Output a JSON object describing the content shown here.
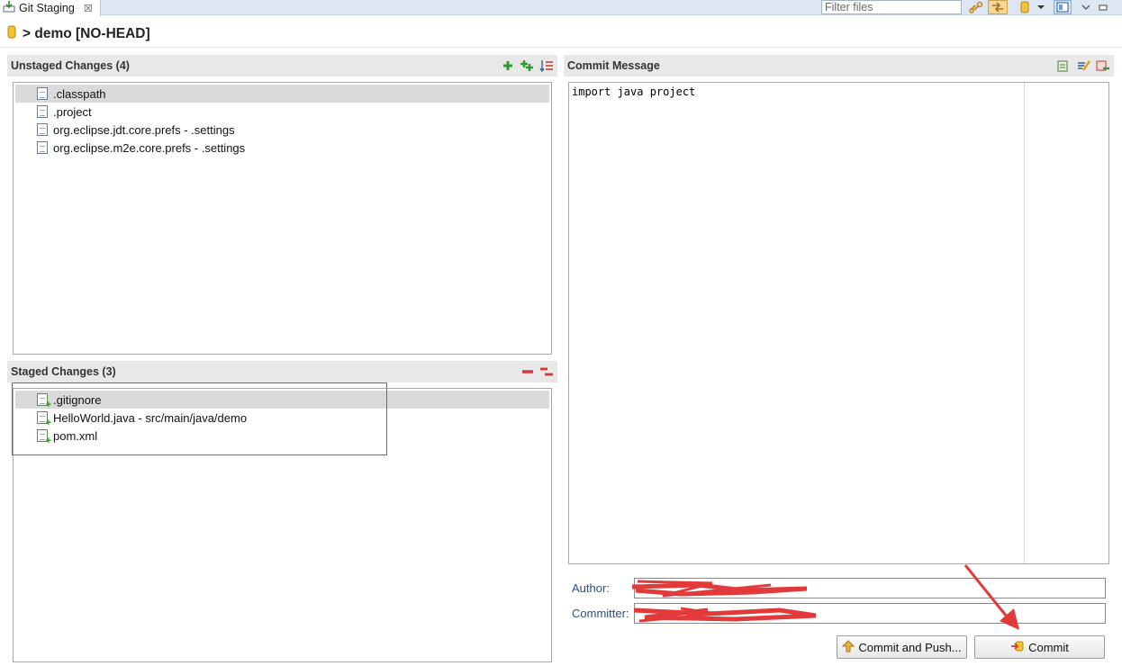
{
  "view": {
    "tab_label": "Git Staging",
    "tab_close": "☒",
    "filter_placeholder": "Filter files"
  },
  "header": {
    "path": "> demo [NO-HEAD]"
  },
  "unstaged": {
    "title": "Unstaged Changes (4)",
    "files": [
      {
        "name": ".classpath"
      },
      {
        "name": ".project"
      },
      {
        "name": "org.eclipse.jdt.core.prefs - .settings"
      },
      {
        "name": "org.eclipse.m2e.core.prefs - .settings"
      }
    ]
  },
  "staged": {
    "title": "Staged Changes (3)",
    "files": [
      {
        "name": ".gitignore"
      },
      {
        "name": "HelloWorld.java - src/main/java/demo"
      },
      {
        "name": "pom.xml"
      }
    ]
  },
  "commit": {
    "title": "Commit Message",
    "message": "import java project",
    "author_label": "Author:",
    "committer_label": "Committer:",
    "commit_and_push_label": "Commit and Push...",
    "commit_label": "Commit"
  },
  "colors": {
    "annotation_red": "#e23a3a",
    "section_header": "#e8e8e8",
    "selection": "#dadada",
    "label_blue": "#2a4e8a"
  }
}
